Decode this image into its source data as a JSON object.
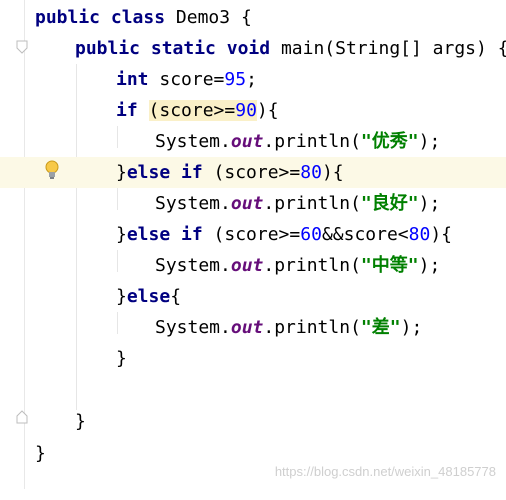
{
  "code_lines": [
    {
      "kw1": "public",
      "kw2": "class",
      "name": "Demo3",
      "brace": "{"
    },
    {
      "kw1": "public",
      "kw2": "static",
      "kw3": "void",
      "sig": "main(String[] args)",
      "brace": "{"
    },
    {
      "kw": "int",
      "var": "score=",
      "num": "95",
      "end": ";"
    },
    {
      "kw": "if",
      "open": "(",
      "cond": "score>=",
      "num": "90",
      "close": ")",
      "brace": "{"
    },
    {
      "pre": "System.",
      "field": "out",
      "call": ".println(",
      "str": "\"优秀\"",
      "end": ");"
    },
    {
      "brace_close": "}",
      "kw": "else if",
      "cond": " (score>=",
      "num": "80",
      "close": ")",
      "brace": "{"
    },
    {
      "pre": "System.",
      "field": "out",
      "call": ".println(",
      "str": "\"良好\"",
      "end": ");"
    },
    {
      "brace_close": "}",
      "kw": "else if",
      "cond": " (score>=",
      "num": "60",
      "mid": "&&score<",
      "num2": "80",
      "close": ")",
      "brace": "{"
    },
    {
      "pre": "System.",
      "field": "out",
      "call": ".println(",
      "str": "\"中等\"",
      "end": ");"
    },
    {
      "brace_close": "}",
      "kw": "else",
      "brace": "{"
    },
    {
      "pre": "System.",
      "field": "out",
      "call": ".println(",
      "str": "\"差\"",
      "end": ");"
    },
    {
      "brace": "}"
    },
    {
      "brace": "}"
    },
    {
      "brace": "}"
    }
  ],
  "watermark": "https://blog.csdn.net/weixin_48185778",
  "colors": {
    "keyword": "#000080",
    "number": "#0000ff",
    "field": "#660e7a",
    "string": "#008000",
    "highlight_line": "#fcf9e6"
  }
}
